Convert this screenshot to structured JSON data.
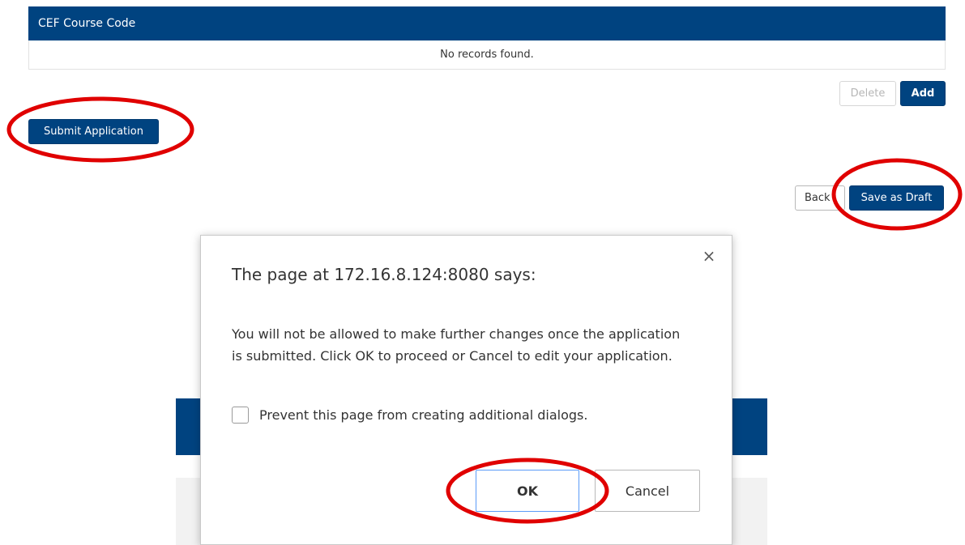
{
  "table": {
    "header": "CEF Course Code",
    "empty_message": "No records found."
  },
  "actions": {
    "delete_label": "Delete",
    "add_label": "Add",
    "submit_label": "Submit Application",
    "back_label": "Back",
    "save_draft_label": "Save as Draft"
  },
  "dialog": {
    "title": "The page at 172.16.8.124:8080 says:",
    "message": "You will not be allowed to make further changes once the application is submitted. Click OK to proceed or Cancel to edit your application.",
    "checkbox_label": "Prevent this page from creating additional dialogs.",
    "checkbox_checked": false,
    "ok_label": "OK",
    "cancel_label": "Cancel",
    "close_symbol": "×"
  },
  "colors": {
    "primary": "#004380",
    "annotation": "#e00000",
    "ok_focus_border": "#5b9bf8"
  }
}
